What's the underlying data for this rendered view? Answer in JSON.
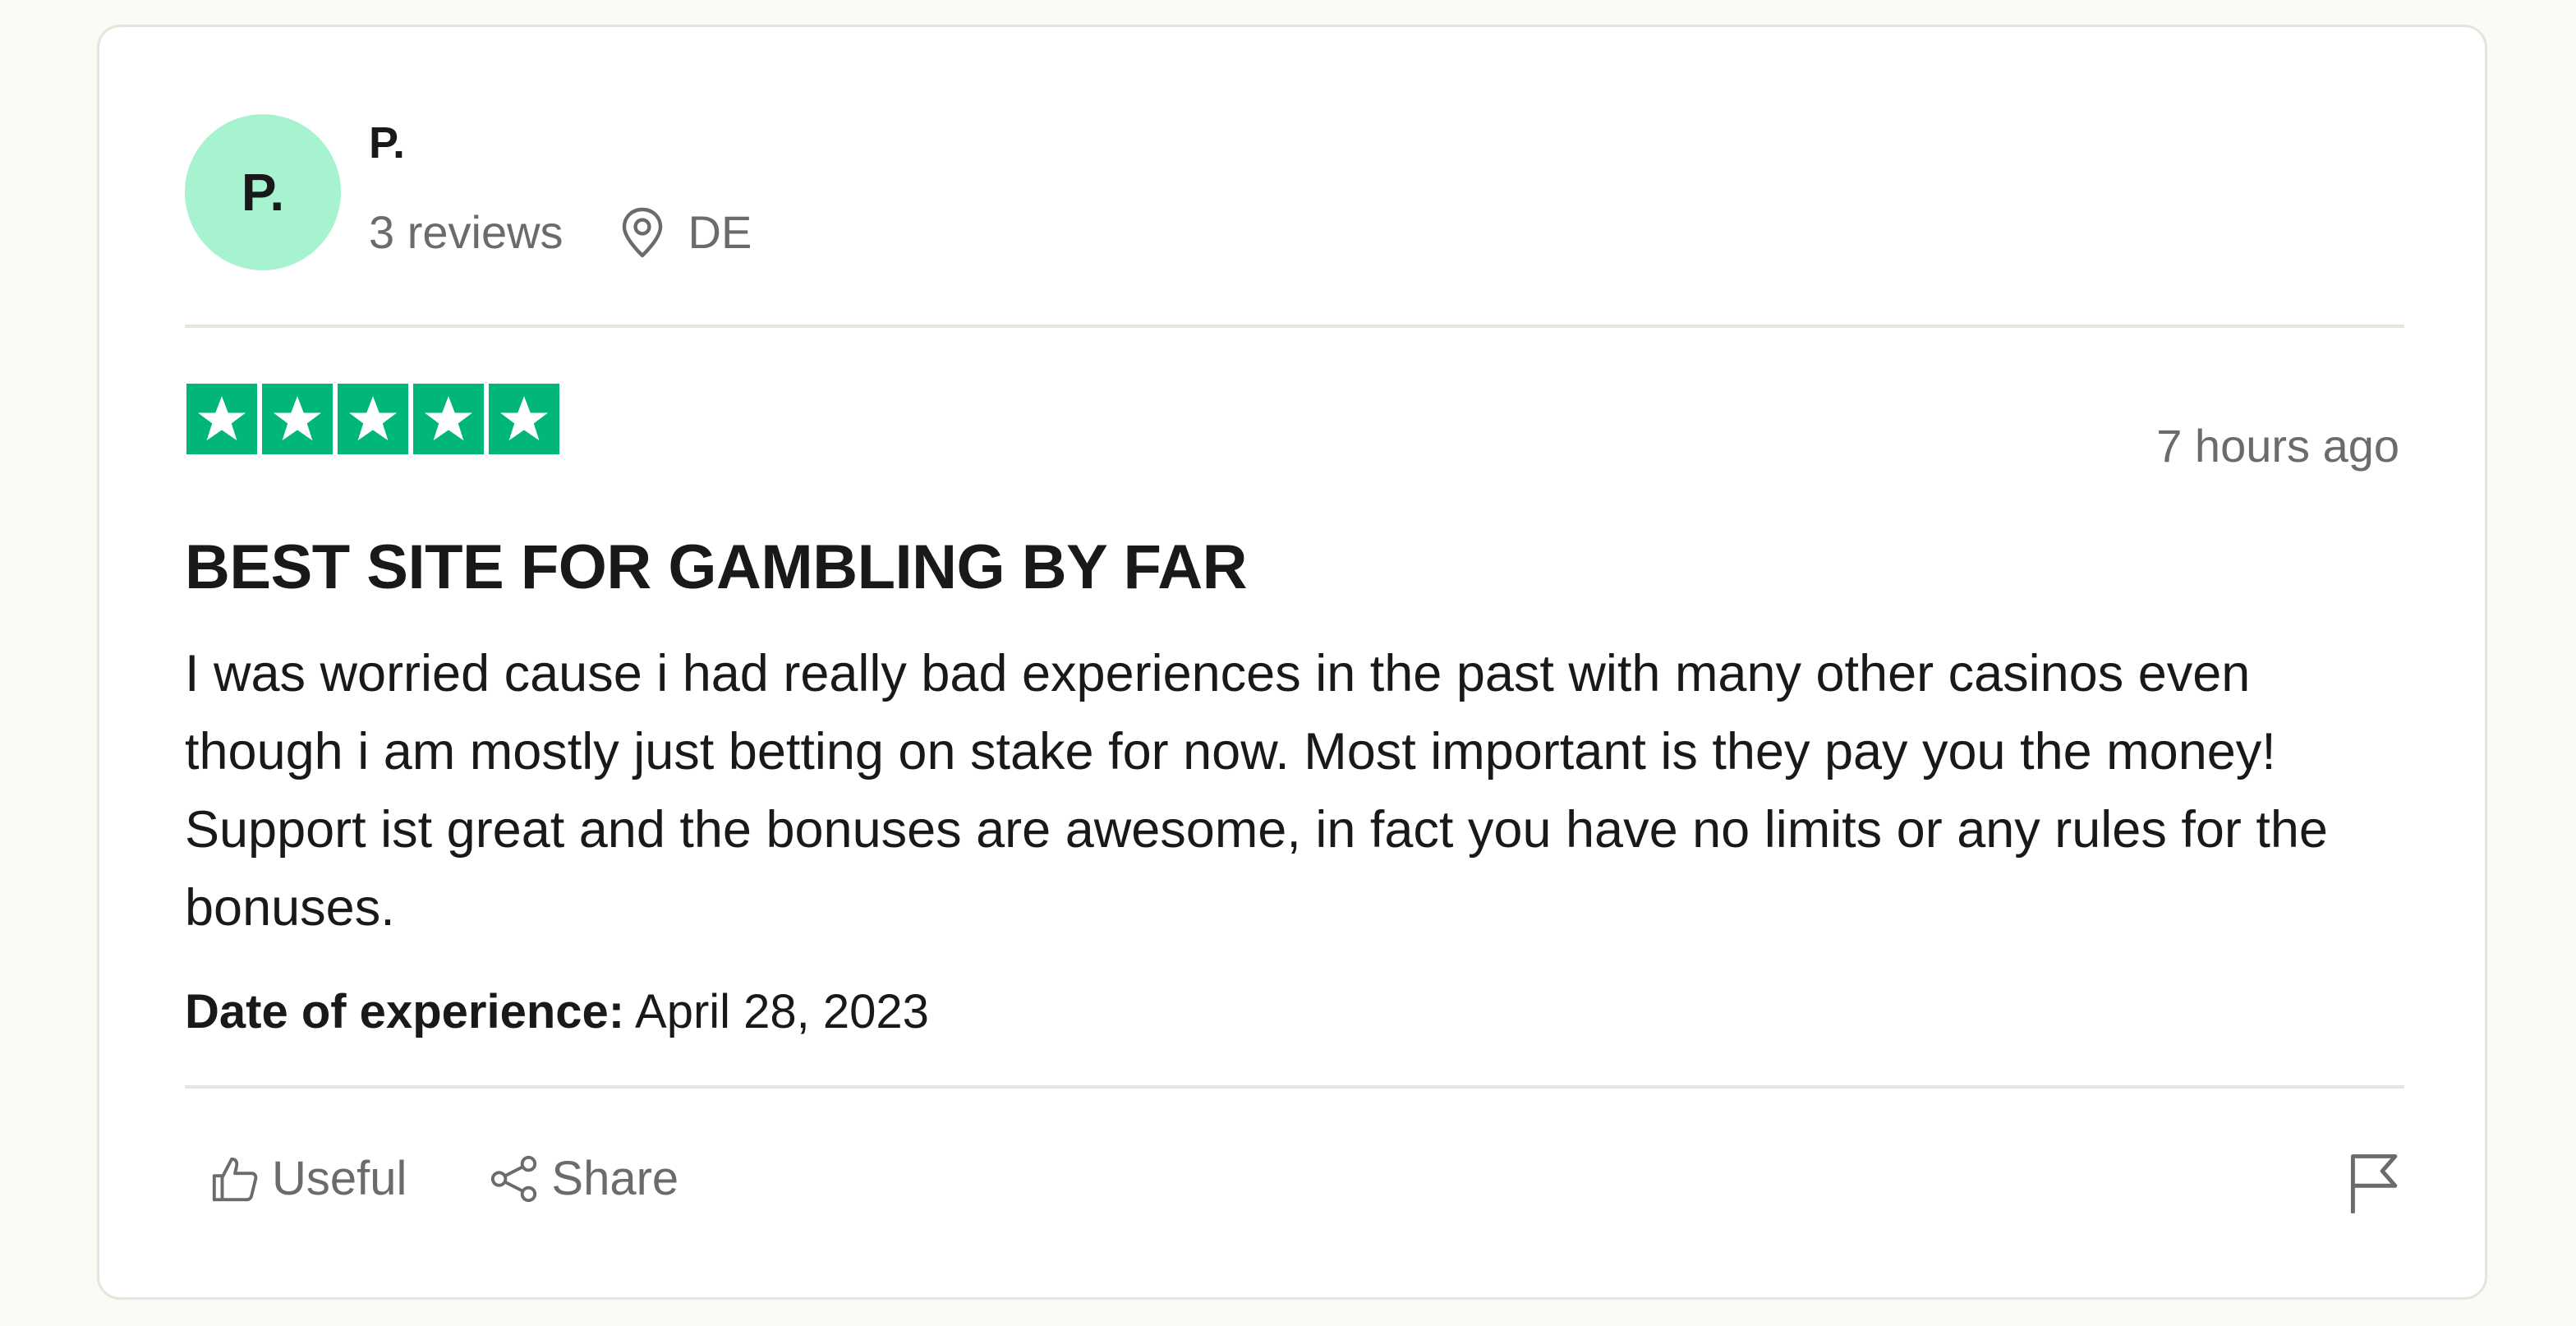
{
  "reviewer": {
    "initials": "P.",
    "name": "P.",
    "reviews_count": "3 reviews",
    "country": "DE"
  },
  "review": {
    "rating": 5,
    "rating_color": "#00b67a",
    "time_ago": "7 hours ago",
    "title": "BEST SITE FOR GAMBLING BY FAR",
    "body": "I was worried cause i had really bad experiences in the past with many other casinos even though i am mostly just betting on stake for now. Most important is they pay you the money! Support ist great and the bonuses are awesome, in fact you have no limits or any rules for the bonuses.",
    "experience_label": "Date of experience:",
    "experience_date": "April 28, 2023"
  },
  "actions": {
    "useful_label": "Useful",
    "share_label": "Share"
  },
  "icons": {
    "location": "location-pin-icon",
    "useful": "thumbs-up-icon",
    "share": "share-icon",
    "report": "flag-icon"
  },
  "colors": {
    "avatar_bg": "#a7f3d0",
    "page_bg": "#fbfbf5",
    "muted_text": "#6b6b6b"
  }
}
